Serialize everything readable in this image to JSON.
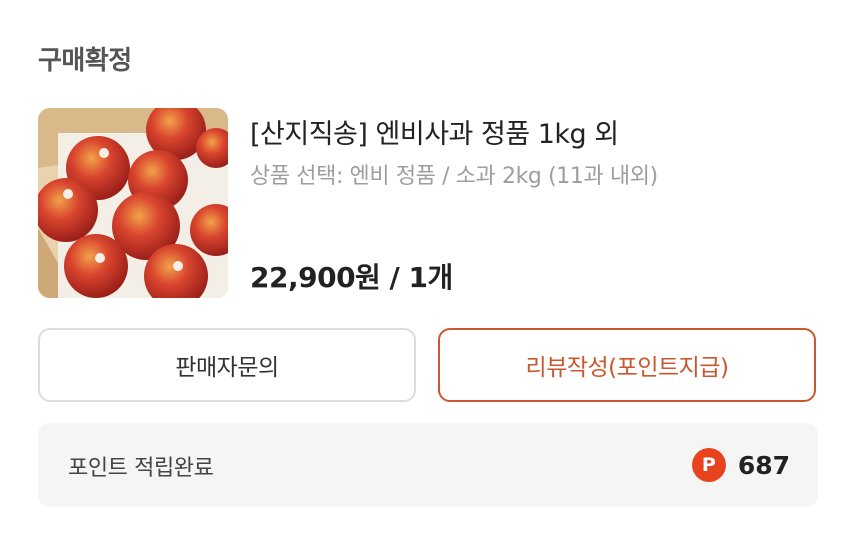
{
  "order": {
    "status_title": "구매확정"
  },
  "product": {
    "image_icon": "apple-box-photo",
    "name": "[산지직송] 엔비사과 정품 1kg 외",
    "option": "상품 선택: 엔비 정품 / 소과 2kg (11과 내외)",
    "price": "22,900원 / 1개"
  },
  "actions": {
    "contact_seller_label": "판매자문의",
    "write_review_label": "리뷰작성(포인트지급)",
    "accent_color": "#c9582e"
  },
  "points": {
    "label": "포인트 적립완료",
    "icon_letter": "P",
    "icon_color": "#e8431f",
    "value": "687"
  }
}
